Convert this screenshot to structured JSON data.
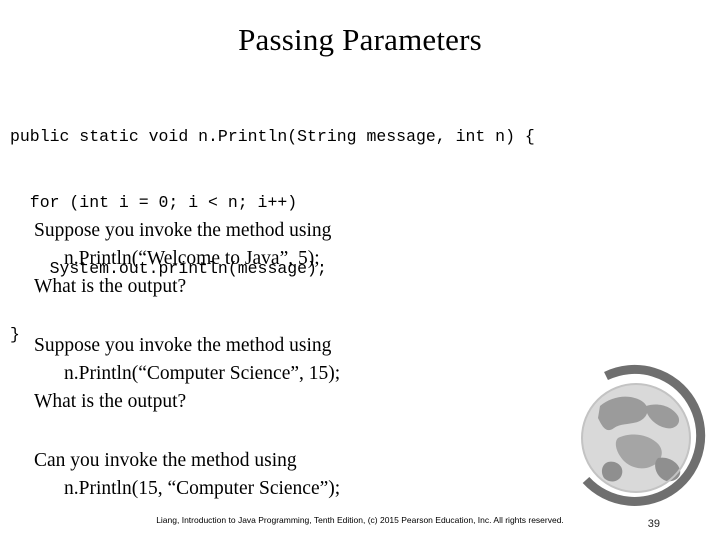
{
  "slide": {
    "title": "Passing Parameters",
    "code_lines": [
      "public static void n.Println(String message, int n) {",
      "  for (int i = 0; i < n; i++)",
      "    System.out.println(message);",
      "}"
    ],
    "paragraphs": [
      {
        "line1": "Suppose you invoke the method using",
        "line2": "n.Println(“Welcome to Java”, 5);",
        "line3": "What is the output?"
      },
      {
        "line1": "Suppose you invoke the method using",
        "line2": "n.Println(“Computer Science”, 15);",
        "line3": "What is the output?"
      },
      {
        "line1": "Can you invoke the method using",
        "line2": "n.Println(15, “Computer Science”);",
        "line3": ""
      }
    ],
    "footer": {
      "line1": "Liang, Introduction to Java Programming, Tenth Edition, (c) 2015 Pearson Education, Inc. All",
      "line2": "rights reserved."
    },
    "page_number": "39",
    "colors": {
      "text": "#000000",
      "background": "#ffffff",
      "globe_dark": "#6f6f6f",
      "globe_mid": "#a8a8a8",
      "globe_light": "#d8d8d8"
    }
  }
}
